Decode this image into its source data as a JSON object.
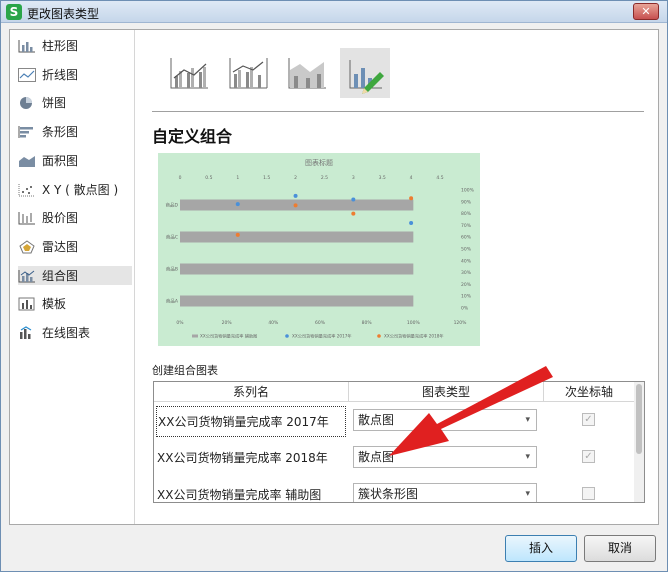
{
  "window": {
    "title": "更改图表类型",
    "app_icon_letter": "S",
    "close_symbol": "✕"
  },
  "sidebar": {
    "items": [
      {
        "label": "柱形图",
        "icon": "column-chart-icon"
      },
      {
        "label": "折线图",
        "icon": "line-chart-icon"
      },
      {
        "label": "饼图",
        "icon": "pie-chart-icon"
      },
      {
        "label": "条形图",
        "icon": "bar-chart-icon"
      },
      {
        "label": "面积图",
        "icon": "area-chart-icon"
      },
      {
        "label": "X Y ( 散点图 )",
        "icon": "scatter-chart-icon"
      },
      {
        "label": "股价图",
        "icon": "stock-chart-icon"
      },
      {
        "label": "雷达图",
        "icon": "radar-chart-icon"
      },
      {
        "label": "组合图",
        "icon": "combo-chart-icon",
        "selected": true
      },
      {
        "label": "模板",
        "icon": "template-icon"
      },
      {
        "label": "在线图表",
        "icon": "online-chart-icon"
      }
    ]
  },
  "main": {
    "heading": "自定义组合",
    "section_label": "创建组合图表"
  },
  "chart_data": {
    "type": "bar",
    "title": "图表标题",
    "top_axis_ticks": [
      "0",
      "0.5",
      "1",
      "1.5",
      "2",
      "2.5",
      "3",
      "3.5",
      "4",
      "4.5"
    ],
    "right_axis_ticks": [
      "100%",
      "90%",
      "80%",
      "70%",
      "60%",
      "50%",
      "40%",
      "30%",
      "20%",
      "10%",
      "0%"
    ],
    "bottom_axis_ticks": [
      "0%",
      "20%",
      "40%",
      "60%",
      "80%",
      "100%",
      "120%"
    ],
    "categories": [
      "商品A",
      "商品B",
      "商品C",
      "商品D"
    ],
    "series": [
      {
        "name": "XX公司货物销量完成率 辅助图",
        "kind": "bar",
        "color": "#a6a6a6",
        "values": [
          1.0,
          1.0,
          1.0,
          1.0
        ]
      },
      {
        "name": "XX公司货物销量完成率 2017年",
        "kind": "scatter",
        "color": "#4a90d9",
        "points": [
          [
            2.0,
            0.95
          ],
          [
            1.0,
            0.88
          ],
          [
            3.0,
            0.92
          ],
          [
            4.0,
            0.72
          ]
        ]
      },
      {
        "name": "XX公司货物销量完成率 2018年",
        "kind": "scatter",
        "color": "#ed7d31",
        "points": [
          [
            2.0,
            0.87
          ],
          [
            1.0,
            0.62
          ],
          [
            3.0,
            0.8
          ],
          [
            4.0,
            0.93
          ]
        ]
      }
    ],
    "legend_position": "bottom"
  },
  "grid": {
    "headers": [
      "系列名",
      "图表类型",
      "次坐标轴"
    ],
    "rows": [
      {
        "name": "XX公司货物销量完成率 2017年",
        "type": "散点图",
        "secondary": true
      },
      {
        "name": "XX公司货物销量完成率 2018年",
        "type": "散点图",
        "secondary": true
      },
      {
        "name": "XX公司货物销量完成率 辅助图",
        "type": "簇状条形图",
        "secondary": false
      }
    ]
  },
  "buttons": {
    "insert": "插入",
    "cancel": "取消"
  },
  "colors": {
    "annotation_arrow": "#e02020",
    "preview_bg": "#c9ebd1",
    "selected_item_bg": "#e5e5e5"
  }
}
